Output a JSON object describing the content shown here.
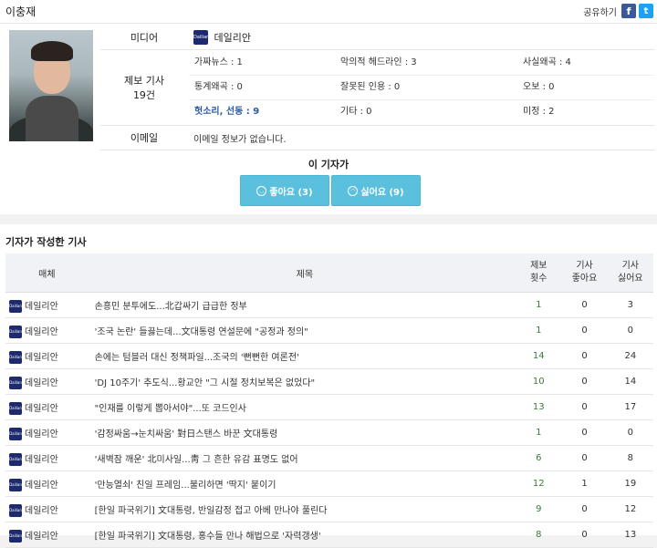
{
  "reporter": {
    "name": "이충재"
  },
  "share": {
    "label": "공유하기",
    "facebook": "f",
    "twitter": "t"
  },
  "profile": {
    "media_label": "미디어",
    "media_name": "데일리안",
    "media_logo_text": "Dailian",
    "report_label": "제보 기사",
    "report_count": "19건",
    "categories": [
      "가짜뉴스 : 1",
      "악의적 헤드라인 : 3",
      "사실왜곡 : 4",
      "통계왜곡 : 0",
      "잘못된 인용 : 0",
      "오보 : 0",
      "헛소리, 선동 : 9",
      "기타 : 0",
      "미정 : 2"
    ],
    "email_label": "이메일",
    "email_value": "이메일 정보가 없습니다."
  },
  "vote": {
    "title": "이 기자가",
    "like_label": "좋아요 (3)",
    "dislike_label": "싫어요 (9)"
  },
  "articles": {
    "section_title": "기자가 작성한 기사",
    "columns": [
      "매체",
      "제목",
      "제보\n횟수",
      "기사\n좋아요",
      "기사\n싫어요"
    ],
    "rows": [
      {
        "media": "데일리안",
        "title": "손흥민 분투에도...北갑싸기 급급한 정부",
        "reports": "1",
        "likes": "0",
        "dislikes": "3"
      },
      {
        "media": "데일리안",
        "title": "'조국 논란' 들끓는데...文대통령 연설문에 \"공정과 정의\"",
        "reports": "1",
        "likes": "0",
        "dislikes": "0"
      },
      {
        "media": "데일리안",
        "title": "손에는 텀블러 대신 정책파일...조국의 '뻔뻔한 여론전'",
        "reports": "14",
        "likes": "0",
        "dislikes": "24"
      },
      {
        "media": "데일리안",
        "title": "'DJ 10주기' 추도식...황교안 \"그 시절 정치보복은 없었다\"",
        "reports": "10",
        "likes": "0",
        "dislikes": "14"
      },
      {
        "media": "데일리안",
        "title": "\"인재를 이렇게 뽑아서야\"...또 코드인사",
        "reports": "13",
        "likes": "0",
        "dislikes": "17"
      },
      {
        "media": "데일리안",
        "title": "'감정싸움→눈치싸움' 對日스탠스 바꾼 文대통령",
        "reports": "1",
        "likes": "0",
        "dislikes": "0"
      },
      {
        "media": "데일리안",
        "title": "'새벽잠 깨운' 北미사일...靑 그 흔한 유감 표명도 없어",
        "reports": "6",
        "likes": "0",
        "dislikes": "8"
      },
      {
        "media": "데일리안",
        "title": "'만능열쇠' 친일 프레임...불리하면 '딱지' 붙이기",
        "reports": "12",
        "likes": "1",
        "dislikes": "19"
      },
      {
        "media": "데일리안",
        "title": "[한일 파국위기] 文대통령, 반일감정 접고 아베 만나야 풀린다",
        "reports": "9",
        "likes": "0",
        "dislikes": "12"
      },
      {
        "media": "데일리안",
        "title": "[한일 파국위기] 文대통령, 홍수들 만나 해법으로 '자력갱생'",
        "reports": "8",
        "likes": "0",
        "dislikes": "13"
      }
    ]
  }
}
